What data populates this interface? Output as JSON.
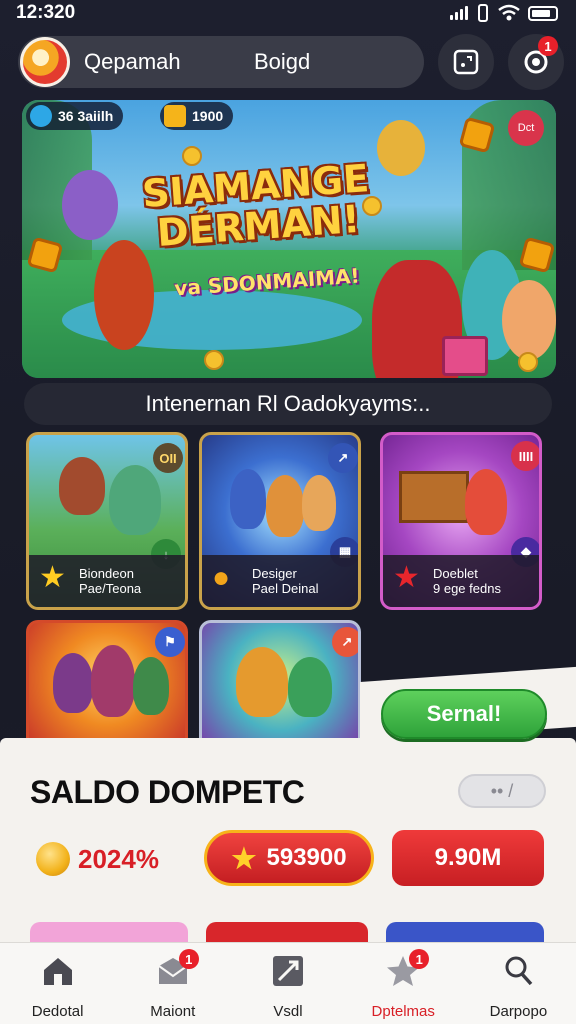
{
  "status_bar": {
    "time": "12:320"
  },
  "header": {
    "search_label_1": "Qepamah",
    "search_label_2": "Boigd",
    "notification_count": "1"
  },
  "banner": {
    "chip_left": "36 3aiilh",
    "chip_right": "1900",
    "corner_badge": "Dct",
    "title": "SIAMANGE DÉRMAN!",
    "subtitle": "va SDONMAIMA!"
  },
  "subtitle_bar": {
    "text": "Intenernan Rl Oadokyayms:.."
  },
  "games": [
    {
      "label_1": "Biondeon",
      "label_2": "Pae/Teona",
      "corner": "OII"
    },
    {
      "label_1": "Desiger",
      "label_2": "Pael Deinal",
      "corner": ""
    },
    {
      "label_1": "Doeblet",
      "label_2": "9 ege fedns",
      "corner": "IIII"
    },
    {
      "label_1": "",
      "label_2": "",
      "corner": ""
    },
    {
      "label_1": "",
      "label_2": "",
      "corner": ""
    }
  ],
  "sheet": {
    "cta_label": "Sernal!",
    "title": "SALDO DOMPETC",
    "toggle_label": "•• /",
    "balance": "2024%",
    "primary_button": "593900",
    "secondary_button": "9.90M",
    "colors": {
      "accent_red": "#d81f26",
      "accent_green": "#2ea33a"
    }
  },
  "nav": {
    "items": [
      {
        "label": "Dedotal",
        "icon": "home-icon",
        "badge": ""
      },
      {
        "label": "Maiont",
        "icon": "mail-icon",
        "badge": "1"
      },
      {
        "label": "Vsdl",
        "icon": "ticket-icon",
        "badge": ""
      },
      {
        "label": "Dptelmas",
        "icon": "star-icon",
        "badge": "1"
      },
      {
        "label": "Darpopo",
        "icon": "profile-icon",
        "badge": ""
      }
    ],
    "active_index": 3
  }
}
